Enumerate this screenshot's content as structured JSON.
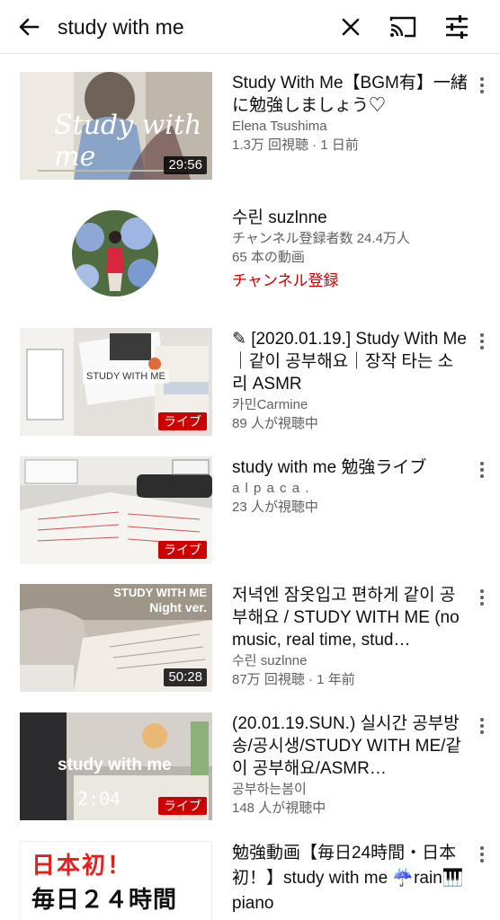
{
  "search": {
    "query": "study with me"
  },
  "header_icons": {
    "back": "arrow-back-icon",
    "clear": "close-icon",
    "cast": "cast-icon",
    "filter": "filter-sliders-icon"
  },
  "colors": {
    "live_badge": "#cc0000",
    "subscribe": "#cc0000",
    "secondary_text": "#606060"
  },
  "results": [
    {
      "kind": "video",
      "title": "Study With Me【BGM有】一緒に勉強しましょう♡",
      "channel": "Elena Tsushima",
      "stats": "1.3万 回視聴 · 1 日前",
      "badge": "29:56",
      "thumb_text": "Study with me"
    },
    {
      "kind": "channel",
      "name": "수린 suzlnne",
      "subscribers": "チャンネル登録者数 24.4万人",
      "video_count": "65 本の動画",
      "subscribe_label": "チャンネル登録"
    },
    {
      "kind": "video",
      "title": "✎ [2020.01.19.] Study With Me｜같이 공부해요｜장작 타는 소리 ASMR",
      "channel": "카민Carmine",
      "stats": "89 人が視聴中",
      "badge": "ライブ",
      "thumb_text": "STUDY WITH ME"
    },
    {
      "kind": "video",
      "title": "study with me 勉強ライブ",
      "channel": "a l p a c a .",
      "stats": "23 人が視聴中",
      "badge": "ライブ"
    },
    {
      "kind": "video",
      "title": "저녁엔 잠옷입고 편하게 같이 공부해요 / STUDY WITH ME (no music, real time, stud…",
      "channel": "수린 suzlnne",
      "stats": "87万 回視聴 · 1 年前",
      "badge": "50:28",
      "thumb_text_1": "STUDY WITH ME",
      "thumb_text_2": "Night ver."
    },
    {
      "kind": "video",
      "title": "(20.01.19.SUN.) 실시간 공부방송/공시생/STUDY WITH ME/같이 공부해요/ASMR…",
      "channel": "공부하는봄이",
      "stats": "148 人が視聴中",
      "badge": "ライブ",
      "thumb_text": "study with me",
      "clock": "2:04"
    },
    {
      "kind": "video",
      "title": "勉強動画【毎日24時間・日本初！】study with me ☔rain🎹piano",
      "thumb_text_1": "日本初！",
      "thumb_text_2": "毎日２４時間"
    }
  ]
}
